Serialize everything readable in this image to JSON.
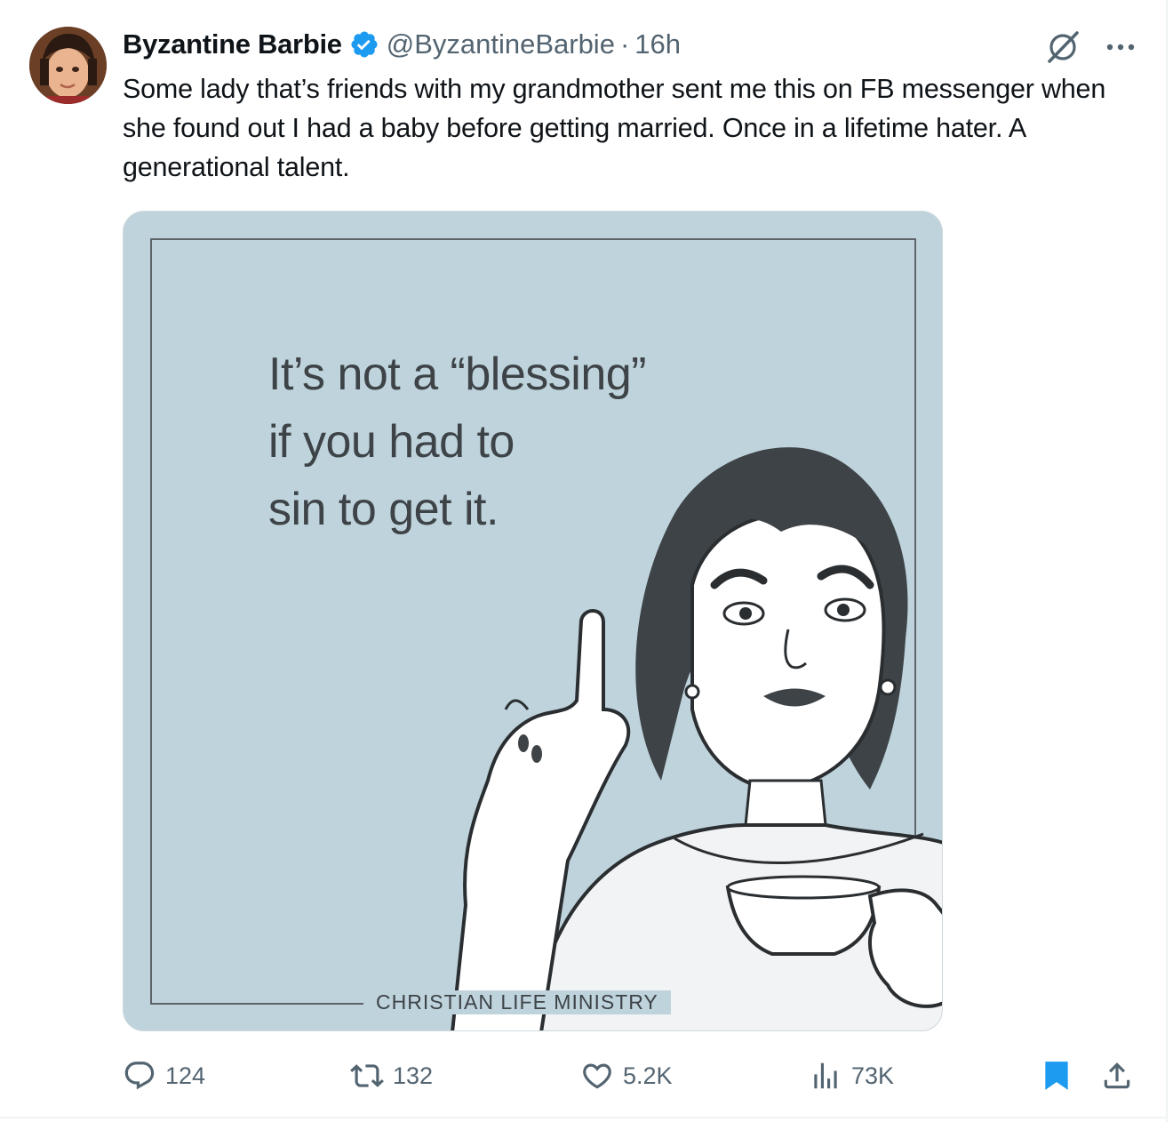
{
  "post": {
    "author_name": "Byzantine Barbie",
    "handle": "@ByzantineBarbie",
    "separator": "·",
    "time": "16h",
    "text": "Some lady that’s friends with my grandmother sent me this on FB messenger when she found out I had a baby before getting married. Once in a lifetime hater. A generational talent.",
    "verified_icon": "verified-badge-icon",
    "accent_color": "#1d9bf0"
  },
  "media": {
    "quote": "It’s not a “blessing”\nif you had to\nsin to get it.",
    "brand": "Christian Life Ministry",
    "background_color": "#bfd3dc"
  },
  "actions": {
    "replies": "124",
    "reposts": "132",
    "likes": "5.2K",
    "views": "73K",
    "bookmark_color": "#1d9bf0"
  },
  "icons": {
    "grok": "grok-icon",
    "more": "more-icon",
    "reply": "reply-icon",
    "repost": "repost-icon",
    "like": "like-icon",
    "views": "views-icon",
    "bookmark": "bookmark-icon",
    "share": "share-icon"
  }
}
